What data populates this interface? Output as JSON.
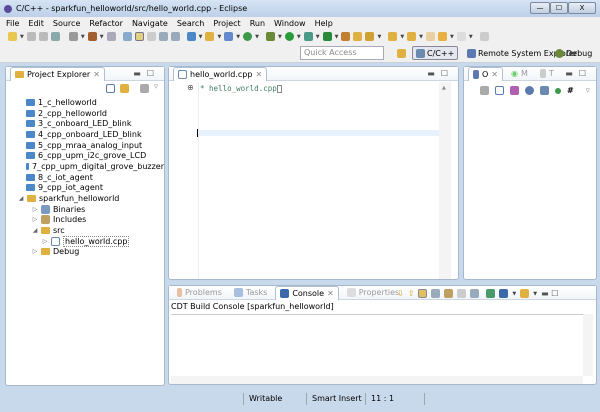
{
  "window": {
    "title": "C/C++ - sparkfun_helloworld/src/hello_world.cpp - Eclipse",
    "min": "—",
    "max": "☐",
    "close": "X"
  },
  "menu": [
    "File",
    "Edit",
    "Source",
    "Refactor",
    "Navigate",
    "Search",
    "Project",
    "Run",
    "Window",
    "Help"
  ],
  "quick_access": {
    "placeholder": "Quick Access"
  },
  "perspectives": {
    "cpp": "C/C++",
    "rse": "Remote System Explorer",
    "debug": "Debug"
  },
  "project_explorer": {
    "title": "Project Explorer",
    "projects": [
      "1_c_helloworld",
      "2_cpp_helloworld",
      "3_c_onboard_LED_blink",
      "4_cpp_onboard_LED_blink",
      "5_cpp_mraa_analog_input",
      "6_cpp_upm_i2c_grove_LCD",
      "7_cpp_upm_digital_grove_buzzer",
      "8_c_iot_agent",
      "9_cpp_iot_agent"
    ],
    "open_project": "sparkfun_helloworld",
    "binaries": "Binaries",
    "includes": "Includes",
    "src": "src",
    "file": "hello_world.cpp",
    "debug": "Debug"
  },
  "editor": {
    "tab": "hello_world.cpp",
    "line1": "* hello_world.cpp"
  },
  "outline": {
    "tabs": [
      "O",
      "M",
      "T"
    ]
  },
  "console": {
    "tabs": [
      "Problems",
      "Tasks",
      "Console",
      "Properties"
    ],
    "label": "CDT Build Console [sparkfun_helloworld]"
  },
  "status": {
    "writable": "Writable",
    "insert": "Smart Insert",
    "position": "11 : 1"
  }
}
